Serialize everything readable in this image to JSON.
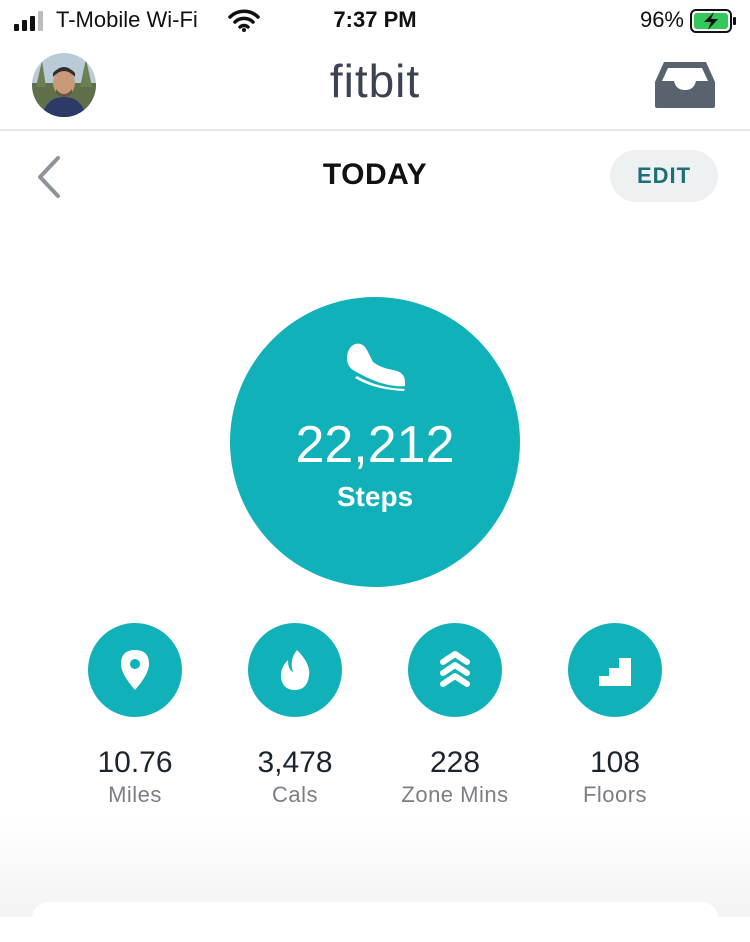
{
  "status_bar": {
    "carrier": "T-Mobile Wi-Fi",
    "time": "7:37 PM",
    "battery_percent": "96%"
  },
  "header": {
    "logo_text": "fitbit",
    "avatar_icon": "user-avatar",
    "inbox_icon": "inbox-icon"
  },
  "date_nav": {
    "title": "TODAY",
    "edit_label": "EDIT",
    "back_icon": "chevron-left-icon"
  },
  "steps": {
    "value": "22,212",
    "label": "Steps",
    "icon": "shoe-icon"
  },
  "stats": [
    {
      "value": "10.76",
      "label": "Miles",
      "icon": "location-pin-icon"
    },
    {
      "value": "3,478",
      "label": "Cals",
      "icon": "flame-icon"
    },
    {
      "value": "228",
      "label": "Zone Mins",
      "icon": "chevrons-up-icon"
    },
    {
      "value": "108",
      "label": "Floors",
      "icon": "stairs-icon"
    }
  ],
  "colors": {
    "accent": "#11b1ba",
    "logo": "#3b4352",
    "edit_text": "#1f6f78",
    "label_gray": "#7a7f86",
    "battery_green": "#34c759"
  }
}
